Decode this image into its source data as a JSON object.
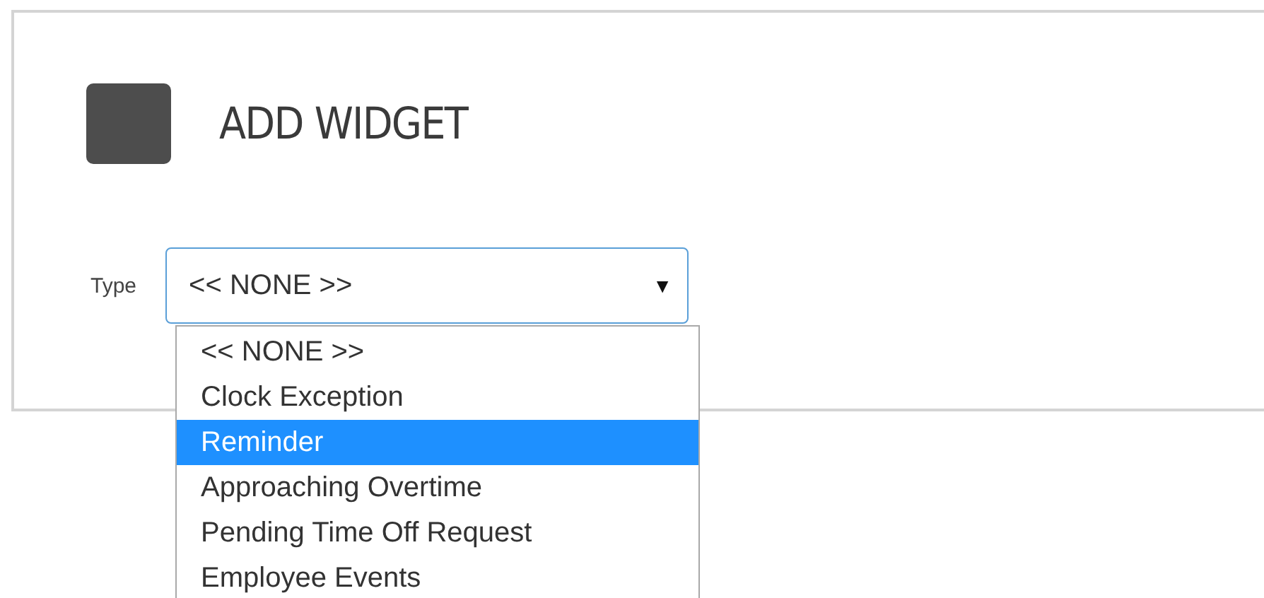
{
  "card": {
    "title": "ADD WIDGET"
  },
  "type_field": {
    "label": "Type",
    "value": "<< NONE >>",
    "expanded": true,
    "caret": "▼",
    "options": [
      {
        "label": "<< NONE >>",
        "highlighted": false
      },
      {
        "label": "Clock Exception",
        "highlighted": false
      },
      {
        "label": "Reminder",
        "highlighted": true
      },
      {
        "label": "Approaching Overtime",
        "highlighted": false
      },
      {
        "label": "Pending Time Off Request",
        "highlighted": false
      },
      {
        "label": "Employee Events",
        "highlighted": false
      }
    ]
  }
}
